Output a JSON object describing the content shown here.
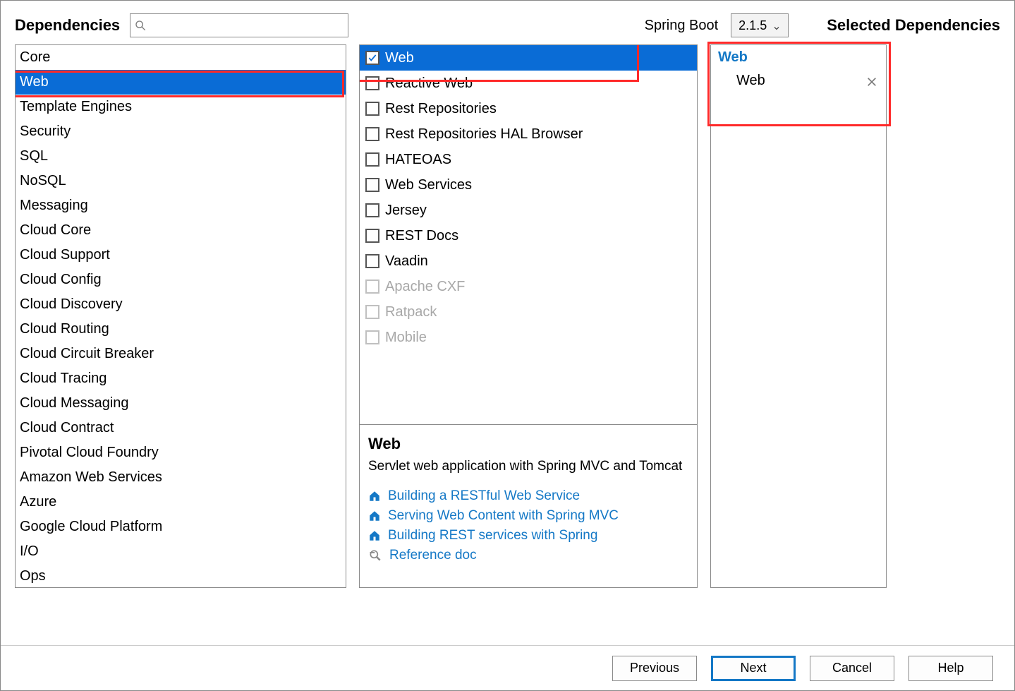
{
  "header": {
    "dependencies_label": "Dependencies",
    "spring_boot_label": "Spring Boot",
    "version": "2.1.5",
    "selected_label": "Selected Dependencies",
    "search_placeholder": ""
  },
  "categories": [
    "Core",
    "Web",
    "Template Engines",
    "Security",
    "SQL",
    "NoSQL",
    "Messaging",
    "Cloud Core",
    "Cloud Support",
    "Cloud Config",
    "Cloud Discovery",
    "Cloud Routing",
    "Cloud Circuit Breaker",
    "Cloud Tracing",
    "Cloud Messaging",
    "Cloud Contract",
    "Pivotal Cloud Foundry",
    "Amazon Web Services",
    "Azure",
    "Google Cloud Platform",
    "I/O",
    "Ops"
  ],
  "selected_category_index": 1,
  "dependencies": [
    {
      "label": "Web",
      "checked": true,
      "selected": true,
      "disabled": false
    },
    {
      "label": "Reactive Web",
      "checked": false,
      "selected": false,
      "disabled": false
    },
    {
      "label": "Rest Repositories",
      "checked": false,
      "selected": false,
      "disabled": false
    },
    {
      "label": "Rest Repositories HAL Browser",
      "checked": false,
      "selected": false,
      "disabled": false
    },
    {
      "label": "HATEOAS",
      "checked": false,
      "selected": false,
      "disabled": false
    },
    {
      "label": "Web Services",
      "checked": false,
      "selected": false,
      "disabled": false
    },
    {
      "label": "Jersey",
      "checked": false,
      "selected": false,
      "disabled": false
    },
    {
      "label": "REST Docs",
      "checked": false,
      "selected": false,
      "disabled": false
    },
    {
      "label": "Vaadin",
      "checked": false,
      "selected": false,
      "disabled": false
    },
    {
      "label": "Apache CXF",
      "checked": false,
      "selected": false,
      "disabled": true
    },
    {
      "label": "Ratpack",
      "checked": false,
      "selected": false,
      "disabled": true
    },
    {
      "label": "Mobile",
      "checked": false,
      "selected": false,
      "disabled": true
    }
  ],
  "description": {
    "title": "Web",
    "text": "Servlet web application with Spring MVC and Tomcat",
    "guides": [
      "Building a RESTful Web Service",
      "Serving Web Content with Spring MVC",
      "Building REST services with Spring"
    ],
    "reference": "Reference doc"
  },
  "selected": {
    "group": "Web",
    "items": [
      "Web"
    ]
  },
  "buttons": {
    "previous": "Previous",
    "next": "Next",
    "cancel": "Cancel",
    "help": "Help"
  },
  "watermark": ""
}
